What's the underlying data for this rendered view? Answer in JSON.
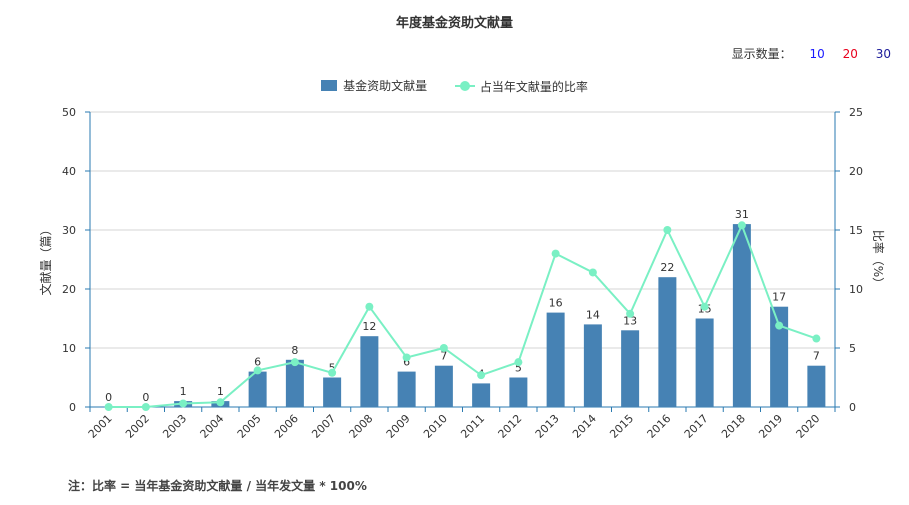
{
  "chart_data": {
    "type": "bar",
    "title": "年度基金资助文献量",
    "categories": [
      "2001",
      "2002",
      "2003",
      "2004",
      "2005",
      "2006",
      "2007",
      "2008",
      "2009",
      "2010",
      "2011",
      "2012",
      "2013",
      "2014",
      "2015",
      "2016",
      "2017",
      "2018",
      "2019",
      "2020"
    ],
    "series": [
      {
        "name": "基金资助文献量",
        "type": "bar",
        "axis": "left",
        "values": [
          0,
          0,
          1,
          1,
          6,
          8,
          5,
          12,
          6,
          7,
          4,
          5,
          16,
          14,
          13,
          22,
          15,
          31,
          17,
          7
        ]
      },
      {
        "name": "占当年文献量的比率",
        "type": "line",
        "axis": "right",
        "values": [
          0,
          0,
          0.3,
          0.4,
          3.1,
          3.8,
          2.9,
          8.5,
          4.2,
          5.0,
          2.7,
          3.8,
          13.0,
          11.4,
          7.9,
          15.0,
          8.5,
          15.4,
          6.9,
          5.8
        ]
      }
    ],
    "ylabel": "文献量（篇）",
    "y2label": "比率（%）",
    "ylim": [
      0,
      50
    ],
    "y2lim": [
      0,
      25
    ],
    "yticks": [
      0,
      10,
      20,
      30,
      40,
      50
    ],
    "y2ticks": [
      0,
      5,
      10,
      15,
      20,
      25
    ],
    "grid": true,
    "legend_position": "top-center",
    "colors": {
      "bar": "#4682b4",
      "line": "#7af0c4",
      "axis": "#2a7ab0",
      "grid": "#d6d6d6"
    }
  },
  "display_count": {
    "label": "显示数量：",
    "options": [
      {
        "text": "10",
        "color": "#1a1aff"
      },
      {
        "text": "20",
        "color": "#e8001c"
      },
      {
        "text": "30",
        "color": "#1a1a99"
      }
    ]
  },
  "footnote": "注：比率 = 当年基金资助文献量 / 当年发文量 * 100%"
}
